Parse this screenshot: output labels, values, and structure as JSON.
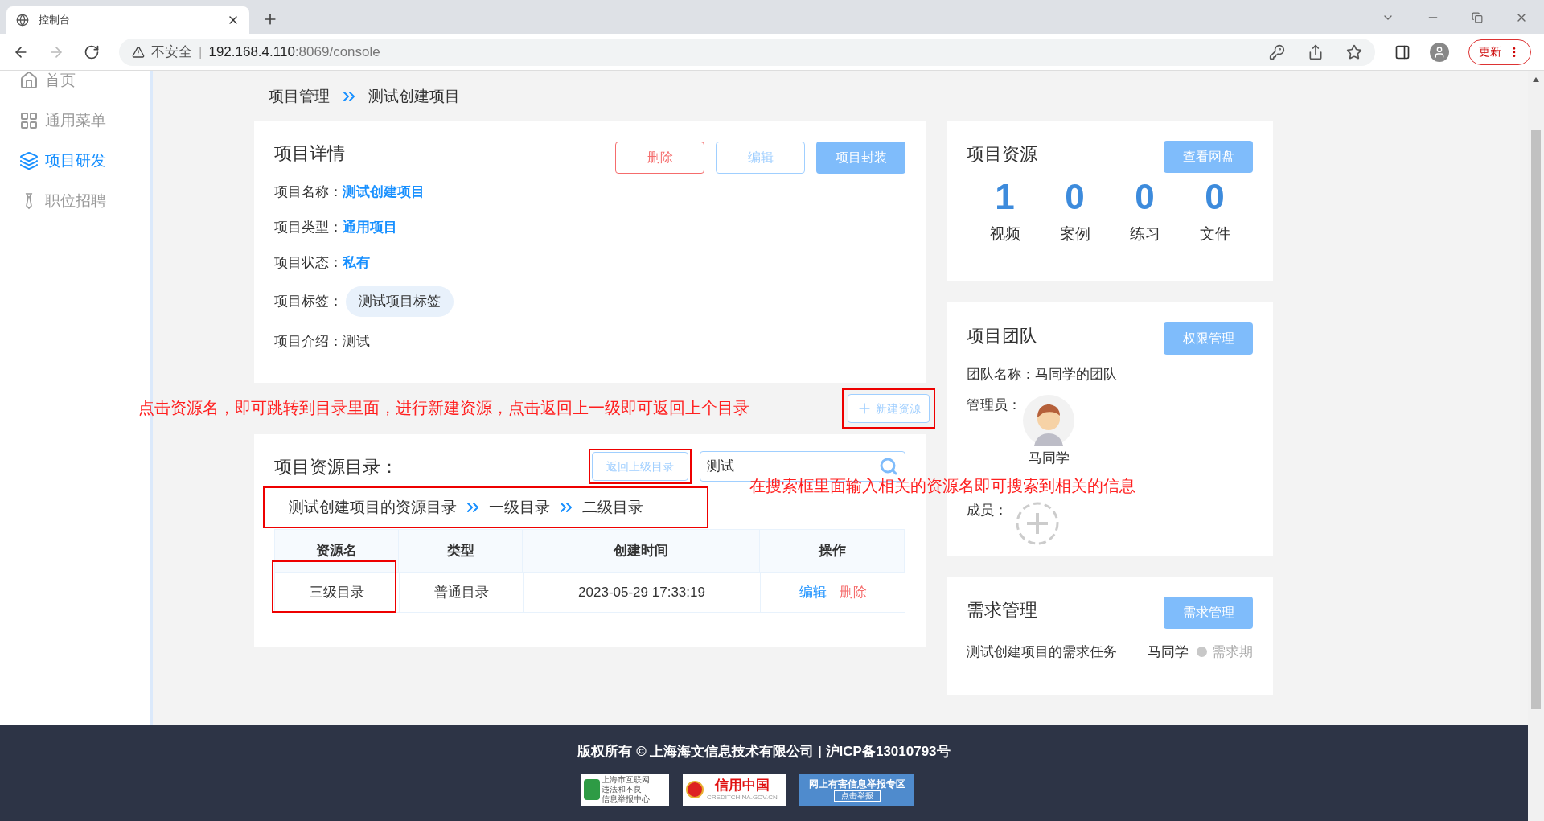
{
  "browser": {
    "tab": {
      "title": "控制台",
      "selected": true
    },
    "security": "不安全",
    "separator": "|",
    "url_host": "192.168.4.110",
    "url_rest": ":8069/console",
    "update_button": "更新"
  },
  "sidebar": {
    "items": [
      {
        "label": "首页",
        "selected": false
      },
      {
        "label": "通用菜单",
        "selected": false
      },
      {
        "label": "项目研发",
        "selected": true
      },
      {
        "label": "职位招聘",
        "selected": false
      }
    ]
  },
  "breadcrumb": [
    "项目管理",
    "测试创建项目"
  ],
  "details": {
    "title": "项目详情",
    "buttons": [
      {
        "label": "删除",
        "kind": "danger"
      },
      {
        "label": "编辑",
        "kind": "outline"
      },
      {
        "label": "项目封装",
        "kind": "primary"
      }
    ],
    "fields": [
      {
        "label": "项目名称：",
        "value": "测试创建项目",
        "kind": "link"
      },
      {
        "label": "项目类型：",
        "value": "通用项目",
        "kind": "link"
      },
      {
        "label": "项目状态：",
        "value": "私有",
        "kind": "link"
      },
      {
        "label": "项目标签：",
        "value": "测试项目标签",
        "kind": "tag"
      },
      {
        "label": "项目介绍：",
        "value": "测试",
        "kind": "plain"
      }
    ]
  },
  "annotations": {
    "nav_hint": "点击资源名，即可跳转到目录里面，进行新建资源，点击返回上一级即可返回上个目录",
    "search_hint": "在搜索框里面输入相关的资源名即可搜索到相关的信息"
  },
  "new_resource_button": "新建资源",
  "resources": {
    "title": "项目资源目录：",
    "back_button": "返回上级目录",
    "search": {
      "value": "测试"
    },
    "path": [
      "测试创建项目的资源目录",
      "一级目录",
      "二级目录"
    ],
    "table": {
      "columns": [
        "资源名",
        "类型",
        "创建时间",
        "操作"
      ],
      "rows": [
        {
          "name": "三级目录",
          "type": "普通目录",
          "created": "2023-05-29 17:33:19",
          "actions": [
            "编辑",
            "删除"
          ]
        }
      ]
    }
  },
  "project_resources": {
    "title": "项目资源",
    "button": "查看网盘",
    "stats": [
      {
        "value": "1",
        "label": "视频"
      },
      {
        "value": "0",
        "label": "案例"
      },
      {
        "value": "0",
        "label": "练习"
      },
      {
        "value": "0",
        "label": "文件"
      }
    ]
  },
  "team": {
    "title": "项目团队",
    "button": "权限管理",
    "name_label": "团队名称：",
    "name": "马同学的团队",
    "admin_label": "管理员：",
    "admin": "马同学",
    "members_label": "成员："
  },
  "demands": {
    "title": "需求管理",
    "button": "需求管理",
    "task": "测试创建项目的需求任务",
    "owner": "马同学",
    "status": {
      "label": "需求期",
      "color": "#c8c8c8"
    }
  },
  "footer": {
    "copyright": "版权所有 © 上海海文信息技术有限公司 | 沪ICP备13010793号",
    "badges": [
      {
        "kind": "report",
        "lines": [
          "上海市互联网",
          "违法和不良",
          "信息举报中心"
        ]
      },
      {
        "kind": "credit",
        "lines": [
          "信用中国",
          "CREDITCHINA.GOV.CN"
        ]
      },
      {
        "kind": "harmful",
        "lines": [
          "网上有害信息举报专区",
          "点击举报"
        ]
      }
    ]
  }
}
